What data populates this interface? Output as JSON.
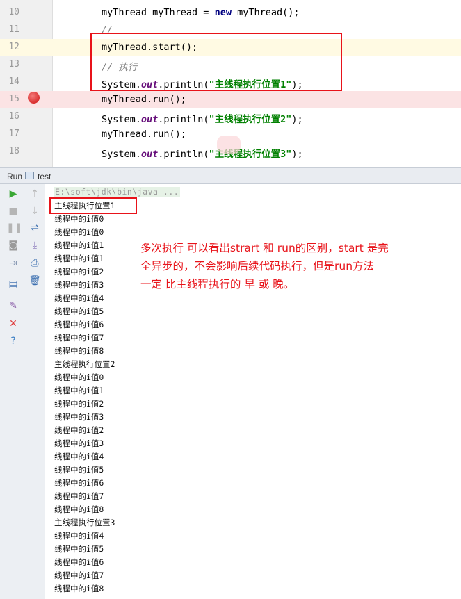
{
  "editor": {
    "lines": [
      {
        "num": "10",
        "parts": [
          {
            "t": "myThread myThread = "
          },
          {
            "t": "new",
            "c": "kw"
          },
          {
            "t": " myThread();"
          }
        ]
      },
      {
        "num": "11",
        "parts": [
          {
            "t": "//",
            "c": "cmt"
          }
        ]
      },
      {
        "num": "12",
        "parts": [
          {
            "t": "myThread.start();"
          }
        ]
      },
      {
        "num": "13",
        "parts": [
          {
            "t": "// 执行",
            "c": "cmt"
          }
        ]
      },
      {
        "num": "14",
        "parts": [
          {
            "t": "System."
          },
          {
            "t": "out",
            "c": "fld"
          },
          {
            "t": ".println("
          },
          {
            "t": "\"主线程执行位置1\"",
            "c": "str"
          },
          {
            "t": ");"
          }
        ]
      },
      {
        "num": "15",
        "parts": [
          {
            "t": "myThread.run();"
          }
        ]
      },
      {
        "num": "16",
        "parts": [
          {
            "t": "System."
          },
          {
            "t": "out",
            "c": "fld"
          },
          {
            "t": ".println("
          },
          {
            "t": "\"主线程执行位置2\"",
            "c": "str"
          },
          {
            "t": ");"
          }
        ]
      },
      {
        "num": "17",
        "parts": [
          {
            "t": "myThread.run();"
          }
        ]
      },
      {
        "num": "18",
        "parts": [
          {
            "t": "System."
          },
          {
            "t": "out",
            "c": "fld"
          },
          {
            "t": ".println("
          },
          {
            "t": "\"主线程执行位置3\"",
            "c": "str"
          },
          {
            "t": ");"
          }
        ]
      }
    ],
    "current_line": "12",
    "breakpoint_line": "15"
  },
  "run_panel": {
    "tab_title": "Run",
    "config_name": "test",
    "command": "E:\\soft\\jdk\\bin\\java ..."
  },
  "toolbar": {
    "left": [
      {
        "name": "rerun-icon",
        "glyph": "▶",
        "color": "#3aa835"
      },
      {
        "name": "stop-icon",
        "glyph": "■",
        "color": "#b5b5b5"
      },
      {
        "name": "pause-icon",
        "glyph": "❚❚",
        "color": "#b5b5b5"
      },
      {
        "name": "dump-threads-icon",
        "glyph": "◙",
        "color": "#9a9a9a"
      },
      {
        "name": "exit-icon",
        "glyph": "⇥",
        "color": "#8a9bb5"
      },
      {
        "name": "layout-icon",
        "glyph": "▤",
        "color": "#4a78b4"
      },
      {
        "name": "pin-icon",
        "glyph": "✎",
        "color": "#8a5da8"
      },
      {
        "name": "close-icon",
        "glyph": "✕",
        "color": "#e03b3b"
      },
      {
        "name": "help-icon",
        "glyph": "?",
        "color": "#3c7fc4"
      }
    ],
    "right": [
      {
        "name": "scroll-up-icon",
        "glyph": "↑",
        "color": "#b5b5b5"
      },
      {
        "name": "scroll-down-icon",
        "glyph": "↓",
        "color": "#b5b5b5"
      },
      {
        "name": "soft-wrap-icon",
        "glyph": "⇌",
        "color": "#3b6fb0"
      },
      {
        "name": "scroll-to-end-icon",
        "glyph": "⤓",
        "color": "#6a52a8"
      },
      {
        "name": "print-icon",
        "glyph": "⎙",
        "color": "#3b6fb0"
      },
      {
        "name": "clear-all-icon",
        "glyph": "🗑",
        "color": "#3b6fb0"
      }
    ]
  },
  "console_lines": [
    "主线程执行位置1",
    "线程中的i值0",
    "线程中的i值0",
    "线程中的i值1",
    "线程中的i值1",
    "线程中的i值2",
    "线程中的i值3",
    "线程中的i值4",
    "线程中的i值5",
    "线程中的i值6",
    "线程中的i值7",
    "线程中的i值8",
    "主线程执行位置2",
    "线程中的i值0",
    "线程中的i值1",
    "线程中的i值2",
    "线程中的i值3",
    "线程中的i值2",
    "线程中的i值3",
    "线程中的i值4",
    "线程中的i值5",
    "线程中的i值6",
    "线程中的i值7",
    "线程中的i值8",
    "主线程执行位置3",
    "线程中的i值4",
    "线程中的i值5",
    "线程中的i值6",
    "线程中的i值7",
    "线程中的i值8"
  ],
  "annotation": [
    "多次执行  可以看出strart 和 run的区别，start 是完",
    "全异步的，不会影响后续代码执行，但是run方法",
    "一定 比主线程执行的 早 或 晚。"
  ],
  "colors": {
    "highlight": "#e8131a",
    "string": "#008000",
    "keyword": "#000080",
    "field": "#660e7a"
  }
}
